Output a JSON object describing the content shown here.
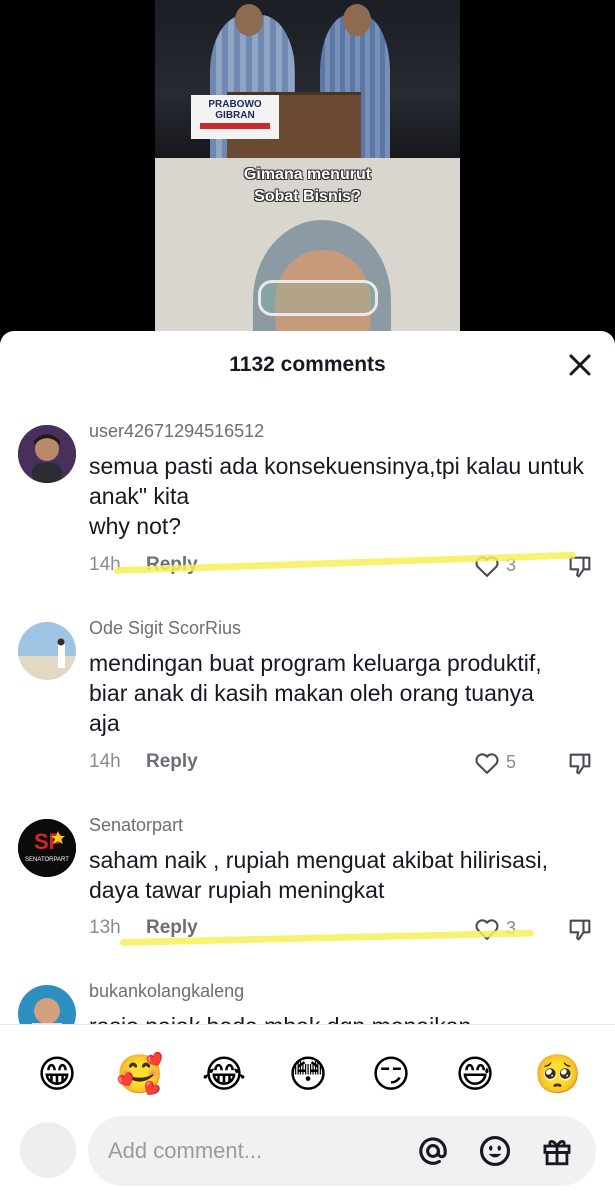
{
  "video": {
    "podium_sign_line1": "PRABOWO",
    "podium_sign_line2": "GIBRAN",
    "overlay_line1": "Gimana menurut",
    "overlay_line2": "Sobat Bisnis?"
  },
  "sheet": {
    "title": "1132 comments",
    "close_icon": "close-icon"
  },
  "comments": [
    {
      "username": "user42671294516512",
      "text": "semua pasti ada konsekuensinya,tpi kalau untuk anak\" kita\nwhy not?",
      "time": "14h",
      "reply": "Reply",
      "likes": "3"
    },
    {
      "username": "Ode Sigit ScorRius",
      "text": "mendingan buat program keluarga produktif, biar anak di kasih makan oleh orang tuanya aja",
      "time": "14h",
      "reply": "Reply",
      "likes": "5"
    },
    {
      "username": "Senatorpart",
      "avatar_text": "SENATORPART",
      "text": "saham naik , rupiah menguat akibat hilirisasi, daya tawar rupiah meningkat",
      "time": "13h",
      "reply": "Reply",
      "likes": "3"
    },
    {
      "username": "bukankolangkaleng",
      "text": "rasio pajak beda mbak dgn menaikan"
    }
  ],
  "emojis": [
    "😁",
    "🥰",
    "😂",
    "😳",
    "😏",
    "😅",
    "🥺"
  ],
  "composer": {
    "placeholder": "Add comment...",
    "icons": [
      "mention-icon",
      "emoji-icon",
      "gift-icon"
    ]
  },
  "colors": {
    "highlight": "#f7f05a",
    "text_primary": "#161823",
    "text_secondary": "#8a8b91"
  }
}
